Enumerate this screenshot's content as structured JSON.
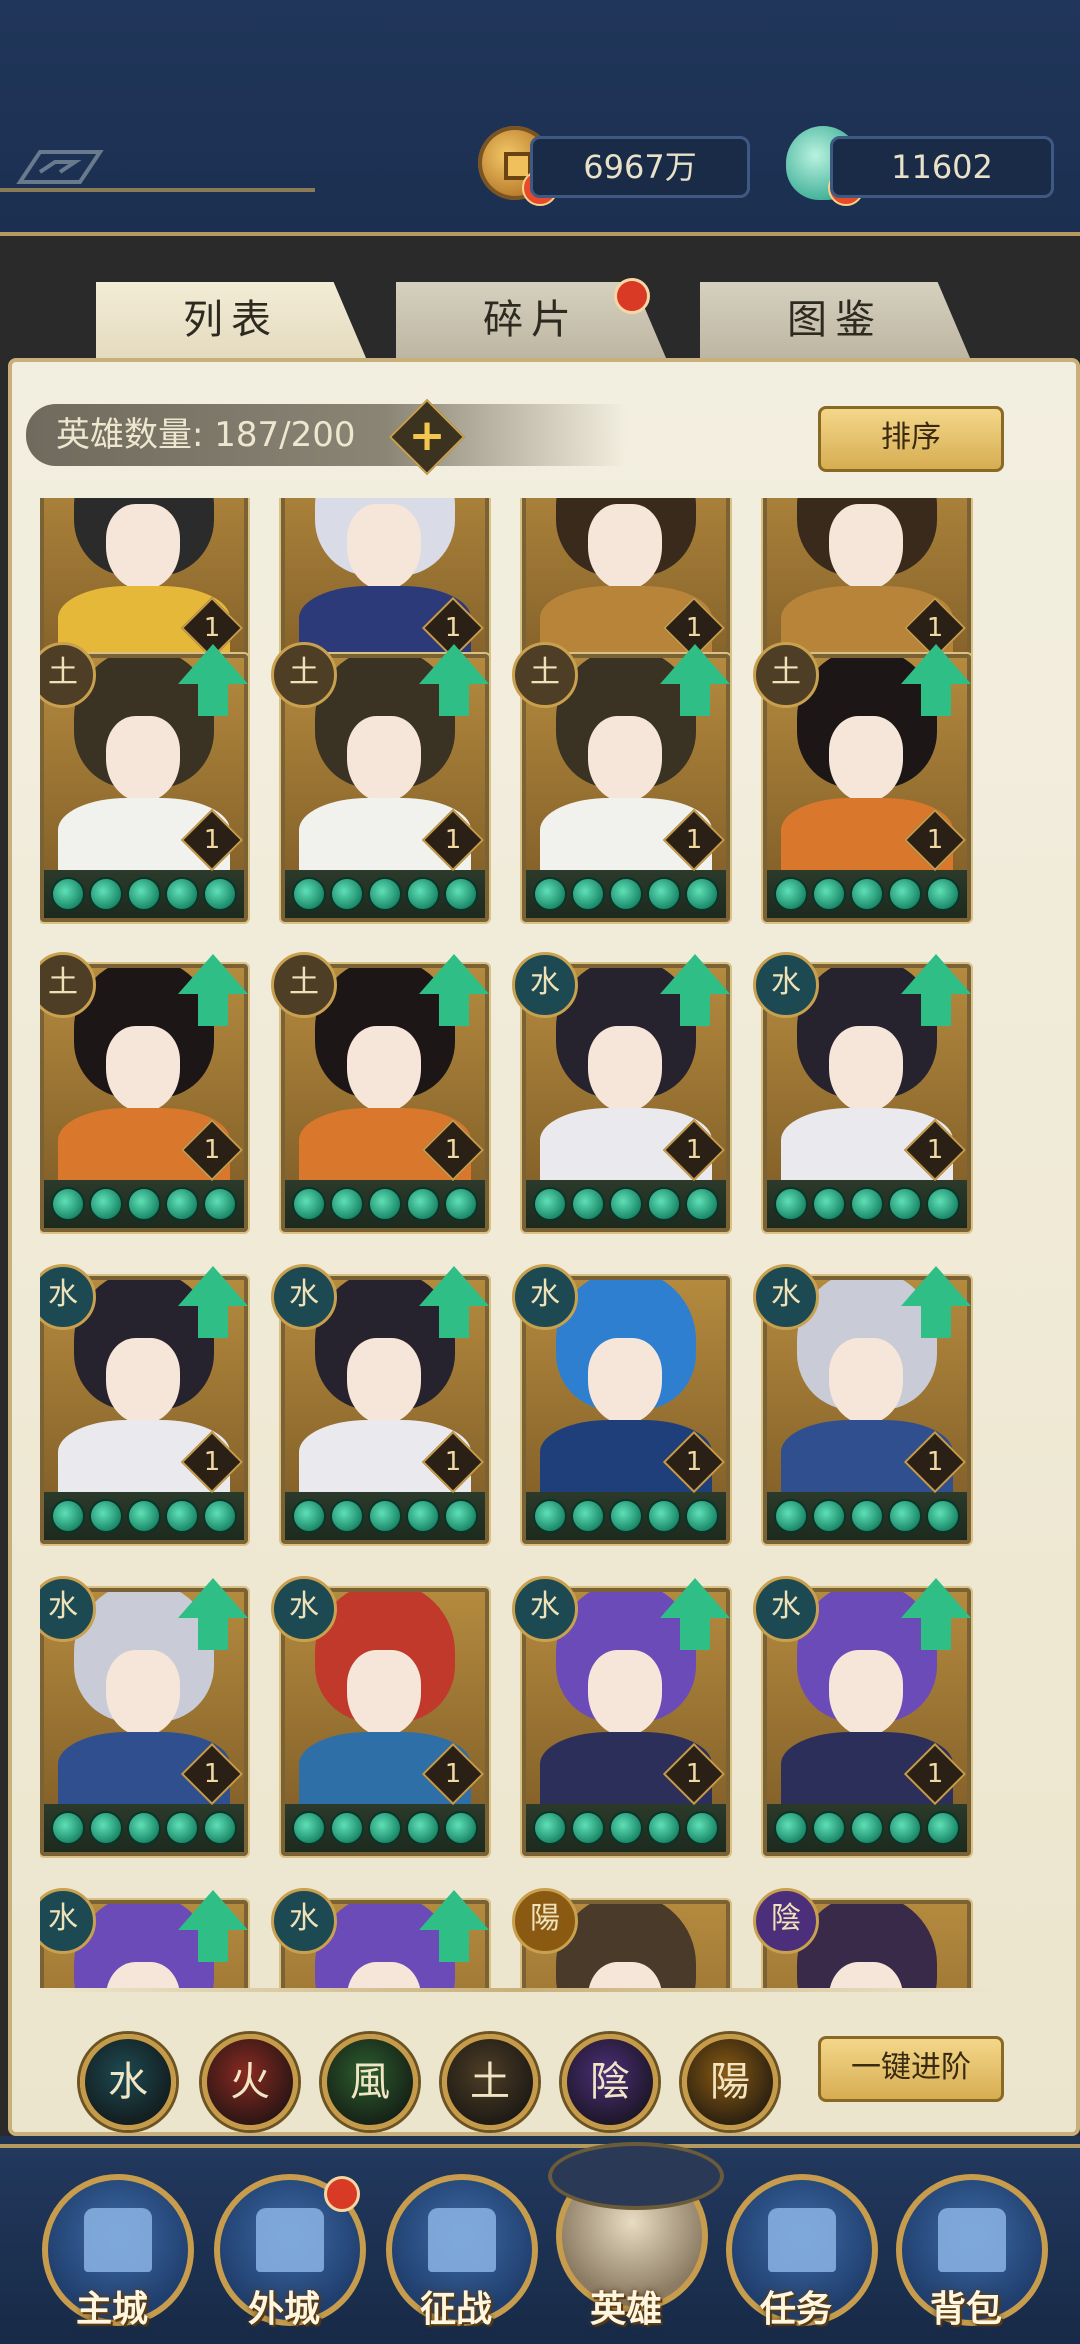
{
  "currency": {
    "coins": "6967万",
    "jade": "11602",
    "plus": "+"
  },
  "tabs": [
    {
      "label": "列表",
      "active": true,
      "badge": false
    },
    {
      "label": "碎片",
      "active": false,
      "badge": true
    },
    {
      "label": "图鉴",
      "active": false,
      "badge": false
    }
  ],
  "hero_count": {
    "label": "英雄数量: 187/200",
    "plus": "+"
  },
  "sort_button": "排序",
  "evolve_button": "一键进阶",
  "cards": [
    {
      "element": "",
      "level": "1",
      "upgrade": false,
      "palette": [
        "#2b2b2b",
        "#e6b83a"
      ]
    },
    {
      "element": "",
      "level": "1",
      "upgrade": false,
      "palette": [
        "#d9dbe6",
        "#2c3a7a"
      ]
    },
    {
      "element": "",
      "level": "1",
      "upgrade": false,
      "palette": [
        "#3a2a1c",
        "#b8843a"
      ]
    },
    {
      "element": "",
      "level": "1",
      "upgrade": false,
      "palette": [
        "#3a2a1c",
        "#b8843a"
      ]
    },
    {
      "element": "土",
      "level": "1",
      "upgrade": true,
      "palette": [
        "#3a3222",
        "#f1f1ee"
      ]
    },
    {
      "element": "土",
      "level": "1",
      "upgrade": true,
      "palette": [
        "#3a3222",
        "#f1f1ee"
      ]
    },
    {
      "element": "土",
      "level": "1",
      "upgrade": true,
      "palette": [
        "#3a3222",
        "#f1f1ee"
      ]
    },
    {
      "element": "土",
      "level": "1",
      "upgrade": true,
      "palette": [
        "#1c1616",
        "#d9772c"
      ]
    },
    {
      "element": "土",
      "level": "1",
      "upgrade": true,
      "palette": [
        "#1c1616",
        "#d9772c"
      ]
    },
    {
      "element": "土",
      "level": "1",
      "upgrade": true,
      "palette": [
        "#1c1616",
        "#d9772c"
      ]
    },
    {
      "element": "水",
      "level": "1",
      "upgrade": true,
      "palette": [
        "#26222e",
        "#e9e9ee"
      ]
    },
    {
      "element": "水",
      "level": "1",
      "upgrade": true,
      "palette": [
        "#26222e",
        "#e9e9ee"
      ]
    },
    {
      "element": "水",
      "level": "1",
      "upgrade": true,
      "palette": [
        "#26222e",
        "#e9e9ee"
      ]
    },
    {
      "element": "水",
      "level": "1",
      "upgrade": true,
      "palette": [
        "#26222e",
        "#e9e9ee"
      ]
    },
    {
      "element": "水",
      "level": "1",
      "upgrade": false,
      "palette": [
        "#2f7fd0",
        "#1f3f7a"
      ]
    },
    {
      "element": "水",
      "level": "1",
      "upgrade": true,
      "palette": [
        "#c9ccd6",
        "#2f4f8f"
      ]
    },
    {
      "element": "水",
      "level": "1",
      "upgrade": true,
      "palette": [
        "#c9ccd6",
        "#2f4f8f"
      ]
    },
    {
      "element": "水",
      "level": "1",
      "upgrade": false,
      "palette": [
        "#c0392b",
        "#2f6fa8"
      ]
    },
    {
      "element": "水",
      "level": "1",
      "upgrade": true,
      "palette": [
        "#6b4bb8",
        "#2b2f5a"
      ]
    },
    {
      "element": "水",
      "level": "1",
      "upgrade": true,
      "palette": [
        "#6b4bb8",
        "#2b2f5a"
      ]
    },
    {
      "element": "水",
      "level": "",
      "upgrade": true,
      "palette": [
        "#6b4bb8",
        "#2b2f5a"
      ]
    },
    {
      "element": "水",
      "level": "",
      "upgrade": true,
      "palette": [
        "#6b4bb8",
        "#2b2f5a"
      ]
    },
    {
      "element": "陽",
      "level": "",
      "upgrade": false,
      "palette": [
        "#4a3a2a",
        "#8b7a60"
      ]
    },
    {
      "element": "陰",
      "level": "",
      "upgrade": false,
      "palette": [
        "#3a2a4a",
        "#6b5a7a"
      ]
    }
  ],
  "element_filters": [
    {
      "label": "水",
      "color": "#1d4a52"
    },
    {
      "label": "火",
      "color": "#8a2a22"
    },
    {
      "label": "風",
      "color": "#2c5e2e"
    },
    {
      "label": "土",
      "color": "#4e3e26"
    },
    {
      "label": "陰",
      "color": "#4c2f7a"
    },
    {
      "label": "陽",
      "color": "#8a5a12"
    }
  ],
  "nav": [
    {
      "label": "主城",
      "badge": false
    },
    {
      "label": "外城",
      "badge": true
    },
    {
      "label": "征战",
      "badge": false
    },
    {
      "label": "英雄",
      "badge": false,
      "active": true
    },
    {
      "label": "任务",
      "badge": false
    },
    {
      "label": "背包",
      "badge": false
    }
  ]
}
